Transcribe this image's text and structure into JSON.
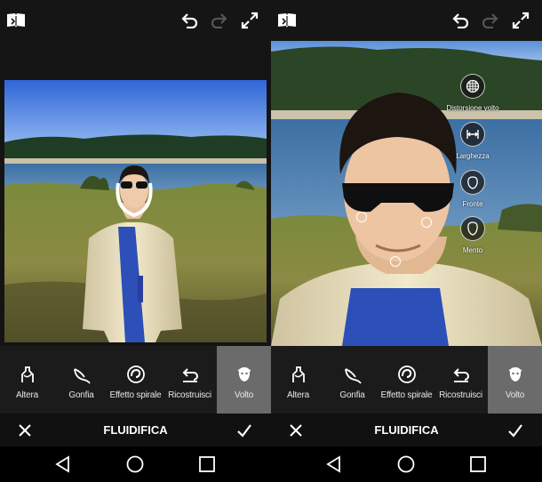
{
  "tools": [
    {
      "label": "Altera",
      "icon": "warp-tool-icon"
    },
    {
      "label": "Gonfia",
      "icon": "bloat-tool-icon"
    },
    {
      "label": "Effetto spirale",
      "icon": "swirl-tool-icon"
    },
    {
      "label": "Ricostruisci",
      "icon": "reconstruct-tool-icon"
    },
    {
      "label": "Volto",
      "icon": "face-tool-icon"
    }
  ],
  "active_tool": "Volto",
  "bottom_title": "FLUIDIFICA",
  "face_tools": [
    {
      "label": "Distorsione volto",
      "icon": "grid-icon"
    },
    {
      "label": "Larghezza",
      "icon": "width-icon"
    },
    {
      "label": "Fronte",
      "icon": "forehead-icon"
    },
    {
      "label": "Mento",
      "icon": "chin-icon"
    }
  ],
  "colors": {
    "toolbar_bg": "#1b1b1b",
    "active_tool_bg": "#6b6b6b",
    "topbar_bg": "#151515"
  },
  "top_icons": [
    "book-icon",
    "undo-icon",
    "redo-icon",
    "fullscreen-icon"
  ],
  "nav_icons": [
    "back-triangle-icon",
    "home-circle-icon",
    "recents-square-icon"
  ]
}
